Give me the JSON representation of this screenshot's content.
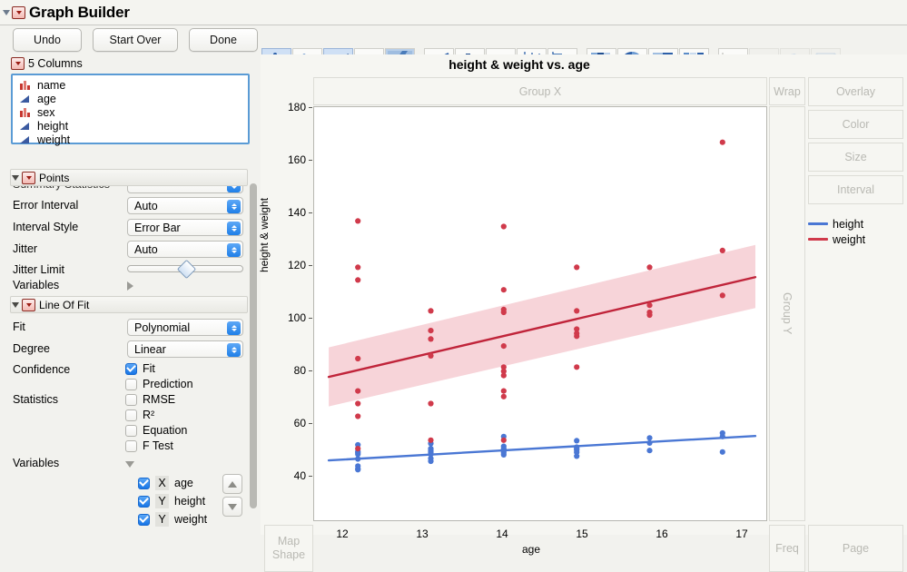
{
  "window": {
    "title": "Graph Builder"
  },
  "toolbar": {
    "undo_label": "Undo",
    "start_over_label": "Start Over",
    "done_label": "Done",
    "icons": [
      {
        "name": "points-icon",
        "selected": true
      },
      {
        "name": "smoother-icon",
        "selected": false
      },
      {
        "name": "line-of-fit-icon",
        "selected": true
      },
      {
        "name": "ellipse-icon",
        "selected": false
      },
      {
        "name": "contour-icon",
        "selected": false
      },
      {
        "name": "line-chart-icon",
        "selected": false
      },
      {
        "name": "bar-chart-icon",
        "selected": false
      },
      {
        "name": "area-chart-icon",
        "selected": false
      },
      {
        "name": "box-plot-icon",
        "selected": false
      },
      {
        "name": "histogram-icon",
        "selected": false
      },
      {
        "name": "heatmap-icon",
        "selected": false
      },
      {
        "name": "pie-chart-icon",
        "selected": false
      },
      {
        "name": "treemap-icon",
        "selected": false
      },
      {
        "name": "mosaic-icon",
        "selected": false
      },
      {
        "name": "caption-box-icon",
        "selected": false
      },
      {
        "name": "formula-icon",
        "selected": false,
        "disabled": true
      },
      {
        "name": "map-shapes-icon",
        "selected": false,
        "disabled": true
      },
      {
        "name": "parallel-plot-icon",
        "selected": false,
        "disabled": true
      }
    ]
  },
  "columns_panel": {
    "header": "5 Columns",
    "items": [
      {
        "label": "name",
        "type": "nominal",
        "icon": "nominal-bars-icon"
      },
      {
        "label": "age",
        "type": "continuous",
        "icon": "continuous-triangle-icon"
      },
      {
        "label": "sex",
        "type": "nominal",
        "icon": "nominal-bars-icon"
      },
      {
        "label": "height",
        "type": "continuous",
        "icon": "continuous-triangle-icon"
      },
      {
        "label": "weight",
        "type": "continuous",
        "icon": "continuous-triangle-icon"
      }
    ]
  },
  "points_section": {
    "title": "Points",
    "rows": [
      {
        "label": "Summary Statistics",
        "value": "",
        "clipped": true
      },
      {
        "label": "Error Interval",
        "value": "Auto"
      },
      {
        "label": "Interval Style",
        "value": "Error Bar"
      },
      {
        "label": "Jitter",
        "value": "Auto"
      }
    ],
    "jitter_limit_label": "Jitter Limit",
    "variables_label": "Variables"
  },
  "line_of_fit_section": {
    "title": "Line Of Fit",
    "fit_label": "Fit",
    "fit_value": "Polynomial",
    "degree_label": "Degree",
    "degree_value": "Linear",
    "confidence_label": "Confidence",
    "statistics_label": "Statistics",
    "variables_label": "Variables",
    "checkboxes": [
      {
        "label": "Fit",
        "checked": true
      },
      {
        "label": "Prediction",
        "checked": false
      },
      {
        "label": "RMSE",
        "checked": false
      },
      {
        "label": "R²",
        "checked": false
      },
      {
        "label": "Equation",
        "checked": false
      },
      {
        "label": "F Test",
        "checked": false
      }
    ],
    "variables": [
      {
        "checked": true,
        "role": "X",
        "name": "age"
      },
      {
        "checked": true,
        "role": "Y",
        "name": "height"
      },
      {
        "checked": true,
        "role": "Y",
        "name": "weight"
      }
    ]
  },
  "dropzones": {
    "group_x": "Group X",
    "group_y": "Group Y",
    "wrap": "Wrap",
    "overlay": "Overlay",
    "color": "Color",
    "size": "Size",
    "interval": "Interval",
    "map_shape": "Map\nShape",
    "freq": "Freq",
    "page": "Page"
  },
  "legend": [
    {
      "label": "height",
      "color": "#4a77d4"
    },
    {
      "label": "weight",
      "color": "#d03a4b"
    }
  ],
  "chart_data": {
    "type": "scatter",
    "title": "height & weight vs. age",
    "xlabel": "age",
    "ylabel": "height & weight",
    "xlim": [
      11.4,
      17.6
    ],
    "ylim": [
      38,
      185
    ],
    "xticks": [
      12,
      13,
      14,
      15,
      16,
      17
    ],
    "yticks": [
      40,
      60,
      80,
      100,
      120,
      140,
      160,
      180
    ],
    "grid": false,
    "legend_position": "right",
    "series": [
      {
        "name": "height",
        "color": "#4a77d4",
        "marker": "circle",
        "points": [
          {
            "x": 12,
            "y": 64.8
          },
          {
            "x": 12,
            "y": 62.5
          },
          {
            "x": 12,
            "y": 62.0
          },
          {
            "x": 12,
            "y": 61.5
          },
          {
            "x": 12,
            "y": 59.8
          },
          {
            "x": 12,
            "y": 57.3
          },
          {
            "x": 12,
            "y": 56.3
          },
          {
            "x": 12,
            "y": 56.0
          },
          {
            "x": 13,
            "y": 65.3
          },
          {
            "x": 13,
            "y": 63.5
          },
          {
            "x": 13,
            "y": 62.8
          },
          {
            "x": 13,
            "y": 62.2
          },
          {
            "x": 13,
            "y": 61.5
          },
          {
            "x": 13,
            "y": 60.0
          },
          {
            "x": 13,
            "y": 59.0
          },
          {
            "x": 14,
            "y": 67.8
          },
          {
            "x": 14,
            "y": 64.3
          },
          {
            "x": 14,
            "y": 63.5
          },
          {
            "x": 14,
            "y": 63.0
          },
          {
            "x": 14,
            "y": 62.5
          },
          {
            "x": 14,
            "y": 62.0
          },
          {
            "x": 14,
            "y": 61.3
          },
          {
            "x": 15,
            "y": 66.3
          },
          {
            "x": 15,
            "y": 64.0
          },
          {
            "x": 15,
            "y": 63.5
          },
          {
            "x": 15,
            "y": 63.0
          },
          {
            "x": 15,
            "y": 62.2
          },
          {
            "x": 15,
            "y": 60.8
          },
          {
            "x": 16,
            "y": 67.3
          },
          {
            "x": 16,
            "y": 65.5
          },
          {
            "x": 16,
            "y": 62.8
          },
          {
            "x": 17,
            "y": 69.0
          },
          {
            "x": 17,
            "y": 67.8
          },
          {
            "x": 17,
            "y": 62.3
          }
        ]
      },
      {
        "name": "weight",
        "color": "#d03a4b",
        "marker": "circle",
        "points": [
          {
            "x": 12,
            "y": 144.5
          },
          {
            "x": 12,
            "y": 128.0
          },
          {
            "x": 12,
            "y": 123.5
          },
          {
            "x": 12,
            "y": 95.5
          },
          {
            "x": 12,
            "y": 84.0
          },
          {
            "x": 12,
            "y": 79.5
          },
          {
            "x": 12,
            "y": 75.0
          },
          {
            "x": 12,
            "y": 63.5
          },
          {
            "x": 13,
            "y": 112.5
          },
          {
            "x": 13,
            "y": 105.5
          },
          {
            "x": 13,
            "y": 102.5
          },
          {
            "x": 13,
            "y": 96.5
          },
          {
            "x": 13,
            "y": 79.5
          },
          {
            "x": 13,
            "y": 66.5
          },
          {
            "x": 14,
            "y": 142.5
          },
          {
            "x": 14,
            "y": 120.0
          },
          {
            "x": 14,
            "y": 113.0
          },
          {
            "x": 14,
            "y": 112.0
          },
          {
            "x": 14,
            "y": 100.0
          },
          {
            "x": 14,
            "y": 92.5
          },
          {
            "x": 14,
            "y": 91.0
          },
          {
            "x": 14,
            "y": 89.5
          },
          {
            "x": 14,
            "y": 84.0
          },
          {
            "x": 14,
            "y": 82.0
          },
          {
            "x": 14,
            "y": 66.5
          },
          {
            "x": 15,
            "y": 128.0
          },
          {
            "x": 15,
            "y": 112.5
          },
          {
            "x": 15,
            "y": 106.0
          },
          {
            "x": 15,
            "y": 104.5
          },
          {
            "x": 15,
            "y": 103.5
          },
          {
            "x": 15,
            "y": 92.5
          },
          {
            "x": 16,
            "y": 128.0
          },
          {
            "x": 16,
            "y": 114.5
          },
          {
            "x": 16,
            "y": 112.0
          },
          {
            "x": 16,
            "y": 111.0
          },
          {
            "x": 17,
            "y": 172.5
          },
          {
            "x": 17,
            "y": 134.0
          },
          {
            "x": 17,
            "y": 118.0
          }
        ]
      }
    ],
    "fits": [
      {
        "name": "height fit",
        "type": "linear",
        "color": "#4a77d4",
        "x_start": 11.6,
        "y_start": 59.3,
        "x_end": 17.45,
        "y_end": 68.0,
        "confidence_band": false
      },
      {
        "name": "weight fit",
        "type": "linear",
        "color": "#c0243a",
        "x_start": 11.6,
        "y_start": 89.0,
        "x_end": 17.45,
        "y_end": 124.5,
        "confidence_band": true,
        "band_color": "#f6ccd2",
        "band_lower_start": 78.5,
        "band_upper_start": 99.5,
        "band_lower_end": 113.5,
        "band_upper_end": 136.0
      }
    ]
  }
}
